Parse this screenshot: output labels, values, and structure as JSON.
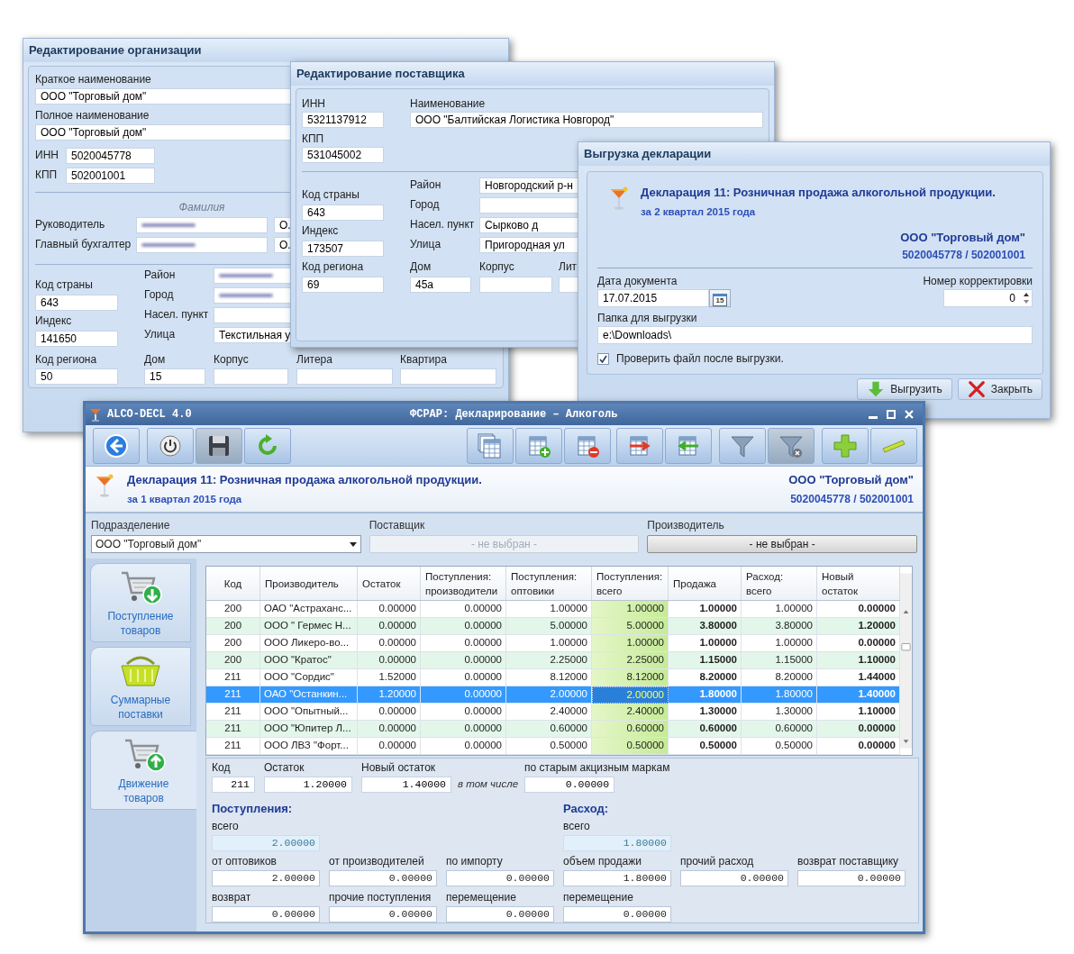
{
  "org_window": {
    "title": "Редактирование организации",
    "short_name": {
      "label": "Краткое наименование",
      "value": "ООО \"Торговый дом\""
    },
    "full_name": {
      "label": "Полное наименование",
      "value": "ООО \"Торговый дом\""
    },
    "inn": {
      "label": "ИНН",
      "value": "5020045778"
    },
    "kpp": {
      "label": "КПП",
      "value": "502001001"
    },
    "surname_header": "Фамилия",
    "people": [
      {
        "label": "Руководитель",
        "blurred": true,
        "initial": "О."
      },
      {
        "label": "Главный бухгалтер",
        "blurred": true,
        "initial": "О."
      }
    ],
    "country_code": {
      "label": "Код страны",
      "value": "643"
    },
    "postal_index": {
      "label": "Индекс",
      "value": "141650"
    },
    "address": [
      {
        "label": "Район",
        "blurred": true
      },
      {
        "label": "Город",
        "blurred": true
      },
      {
        "label": "Насел. пункт",
        "blurred": false
      },
      {
        "label": "Улица",
        "blurred": false,
        "value": "Текстильная у"
      }
    ],
    "bottom_row": [
      {
        "label": "Код региона",
        "value": "50"
      },
      {
        "label": "Дом",
        "value": "15"
      },
      {
        "label": "Корпус"
      },
      {
        "label": "Литера"
      },
      {
        "label": "Квартира"
      }
    ]
  },
  "supplier_window": {
    "title": "Редактирование поставщика",
    "inn": {
      "label": "ИНН",
      "value": "5321137912"
    },
    "name": {
      "label": "Наименование",
      "value": "ООО \"Балтийская Логистика Новгород\""
    },
    "kpp": {
      "label": "КПП",
      "value": "531045002"
    },
    "country_code": {
      "label": "Код страны",
      "value": "643"
    },
    "postal_index": {
      "label": "Индекс",
      "value": "173507"
    },
    "region_code": {
      "label": "Код региона",
      "value": "69"
    },
    "address": [
      {
        "label": "Район",
        "value": "Новгородский р-н"
      },
      {
        "label": "Город"
      },
      {
        "label": "Насел. пункт",
        "value": "Сырково д"
      },
      {
        "label": "Улица",
        "value": "Пригородная ул"
      }
    ],
    "bottom_row": [
      {
        "label": "Дом",
        "value": "45а"
      },
      {
        "label": "Корпус"
      },
      {
        "label": "Лит"
      }
    ]
  },
  "export_window": {
    "title": "Выгрузка декларации",
    "declaration_title": "Декларация 11: Розничная продажа алкогольной продукции.",
    "period": "за 2 квартал 2015 года",
    "org_name": "ООО \"Торговый дом\"",
    "org_codes": "5020045778 / 502001001",
    "date": {
      "label": "Дата документа",
      "value": "17.07.2015"
    },
    "calendar_day": "15",
    "correction": {
      "label": "Номер корректировки",
      "value": "0"
    },
    "folder": {
      "label": "Папка для выгрузки",
      "value": "e:\\Downloads\\"
    },
    "verify": {
      "label": "Проверить файл после выгрузки.",
      "checked": true
    },
    "buttons": [
      {
        "label": "Выгрузить",
        "kind": "export"
      },
      {
        "label": "Закрыть",
        "kind": "close"
      }
    ]
  },
  "main_window": {
    "app_name": "ALCO-DECL 4.0",
    "title": "ФСРАР: Декларирование – Алкоголь",
    "declaration_title": "Декларация 11: Розничная продажа алкогольной продукции.",
    "period": "за 1 квартал 2015 года",
    "org_name": "ООО \"Торговый дом\"",
    "org_codes": "5020045778 / 502001001",
    "filters": [
      {
        "label": "Подразделение",
        "value": "ООО \"Торговый дом\"",
        "kind": "dropdown",
        "disabled": false
      },
      {
        "label": "Поставщик",
        "value": "- не выбран -",
        "kind": "picker",
        "disabled": true
      },
      {
        "label": "Производитель",
        "value": "- не выбран -",
        "kind": "picker",
        "disabled": false
      }
    ],
    "nav": [
      {
        "label": "Поступление товаров",
        "kind": "cart-in",
        "selected": false
      },
      {
        "label": "Суммарные поставки",
        "kind": "basket",
        "selected": false
      },
      {
        "label": "Движение товаров",
        "kind": "cart-out",
        "selected": true
      }
    ],
    "table": {
      "columns": [
        {
          "label": "Код"
        },
        {
          "label": "Производитель"
        },
        {
          "label": "Остаток"
        },
        {
          "label": "Поступления:\nпроизводители"
        },
        {
          "label": "Поступления:\nоптовики"
        },
        {
          "label": "Поступления:\nвсего"
        },
        {
          "label": "Продажа"
        },
        {
          "label": "Расход:\nвсего"
        },
        {
          "label": "Новый\nостаток"
        }
      ],
      "rows": [
        {
          "selected": false,
          "focused": false,
          "cells": [
            "200",
            "ОАО \"Астраханс...",
            "0.00000",
            "0.00000",
            "1.00000",
            "1.00000",
            "1.00000",
            "1.00000",
            "0.00000"
          ]
        },
        {
          "selected": false,
          "focused": false,
          "cells": [
            "200",
            "ООО \" Гермес Н...",
            "0.00000",
            "0.00000",
            "5.00000",
            "5.00000",
            "3.80000",
            "3.80000",
            "1.20000"
          ]
        },
        {
          "selected": false,
          "focused": false,
          "cells": [
            "200",
            "ООО Ликеро-во...",
            "0.00000",
            "0.00000",
            "1.00000",
            "1.00000",
            "1.00000",
            "1.00000",
            "0.00000"
          ]
        },
        {
          "selected": false,
          "focused": false,
          "cells": [
            "200",
            "ООО \"Кратос\"",
            "0.00000",
            "0.00000",
            "2.25000",
            "2.25000",
            "1.15000",
            "1.15000",
            "1.10000"
          ]
        },
        {
          "selected": false,
          "focused": false,
          "cells": [
            "211",
            "ООО \"Сордис\"",
            "1.52000",
            "0.00000",
            "8.12000",
            "8.12000",
            "8.20000",
            "8.20000",
            "1.44000"
          ]
        },
        {
          "selected": true,
          "focused": true,
          "cells": [
            "211",
            "ОАО \"Останкин...",
            "1.20000",
            "0.00000",
            "2.00000",
            "2.00000",
            "1.80000",
            "1.80000",
            "1.40000"
          ]
        },
        {
          "selected": false,
          "focused": false,
          "cells": [
            "211",
            "ООО \"Опытный...",
            "0.00000",
            "0.00000",
            "2.40000",
            "2.40000",
            "1.30000",
            "1.30000",
            "1.10000"
          ]
        },
        {
          "selected": false,
          "focused": false,
          "cells": [
            "211",
            "ООО \"Юпитер Л...",
            "0.00000",
            "0.00000",
            "0.60000",
            "0.60000",
            "0.60000",
            "0.60000",
            "0.00000"
          ]
        },
        {
          "selected": false,
          "focused": false,
          "cells": [
            "211",
            "ООО ЛВЗ \"Форт...",
            "0.00000",
            "0.00000",
            "0.50000",
            "0.50000",
            "0.50000",
            "0.50000",
            "0.00000"
          ]
        }
      ]
    },
    "details": {
      "code": {
        "label": "Код",
        "value": "211"
      },
      "balance": {
        "label": "Остаток",
        "value": "1.20000"
      },
      "new_balance": {
        "label": "Новый остаток",
        "value": "1.40000"
      },
      "including_note": "в том числе",
      "old_stamps": {
        "label": "по старым акцизным маркам",
        "value": "0.00000"
      },
      "income": {
        "title": "Поступления:",
        "total": {
          "label": "всего",
          "value": "2.00000"
        },
        "fields": [
          {
            "label": "от оптовиков",
            "value": "2.00000"
          },
          {
            "label": "от производителей",
            "value": "0.00000"
          },
          {
            "label": "по импорту",
            "value": "0.00000"
          },
          {
            "label": "возврат",
            "value": "0.00000"
          },
          {
            "label": "прочие поступления",
            "value": "0.00000"
          },
          {
            "label": "перемещение",
            "value": "0.00000"
          }
        ]
      },
      "expense": {
        "title": "Расход:",
        "total": {
          "label": "всего",
          "value": "1.80000"
        },
        "fields": [
          {
            "label": "объем продажи",
            "value": "1.80000"
          },
          {
            "label": "прочий расход",
            "value": "0.00000"
          },
          {
            "label": "возврат поставщику",
            "value": "0.00000"
          },
          {
            "label": "перемещение",
            "value": "0.00000"
          }
        ]
      }
    }
  }
}
